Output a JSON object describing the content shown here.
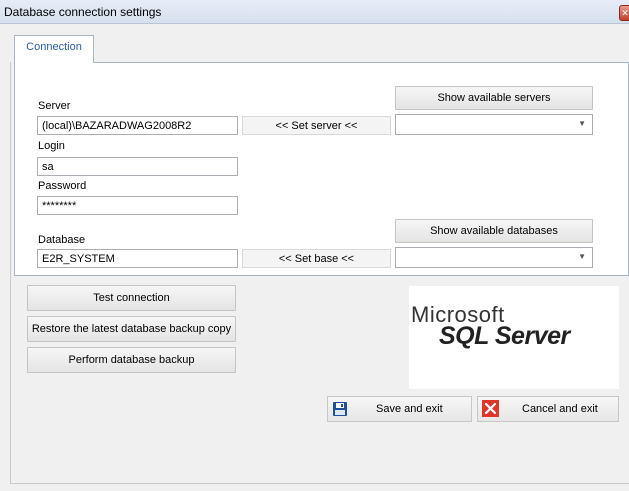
{
  "window": {
    "title": "Database connection settings",
    "close_glyph": "✕"
  },
  "tabs": [
    {
      "label": "Connection"
    }
  ],
  "server": {
    "label": "Server",
    "value": "(local)\\BAZARADWAG2008R2",
    "set_button": "<< Set server <<",
    "show_button": "Show available servers",
    "combo_value": ""
  },
  "login": {
    "label": "Login",
    "value": "sa"
  },
  "password": {
    "label": "Password",
    "value": "********"
  },
  "database": {
    "label": "Database",
    "value": "E2R_SYSTEM",
    "set_button": "<< Set base <<",
    "show_button": "Show available databases",
    "combo_value": ""
  },
  "actions": {
    "test": "Test connection",
    "restore": "Restore the latest database backup copy",
    "backup": "Perform database backup",
    "save_exit": "Save and exit",
    "cancel_exit": "Cancel and exit"
  },
  "logo": {
    "line1": "Microsoft",
    "line2": "SQL Server"
  },
  "icons": {
    "save": "floppy-disk-icon",
    "cancel": "red-x-icon",
    "dropdown": "chevron-down-icon",
    "close": "close-icon"
  },
  "colors": {
    "tab_text": "#2b5ea8",
    "cancel_red": "#e0362a",
    "save_blue": "#1f4e9c"
  }
}
